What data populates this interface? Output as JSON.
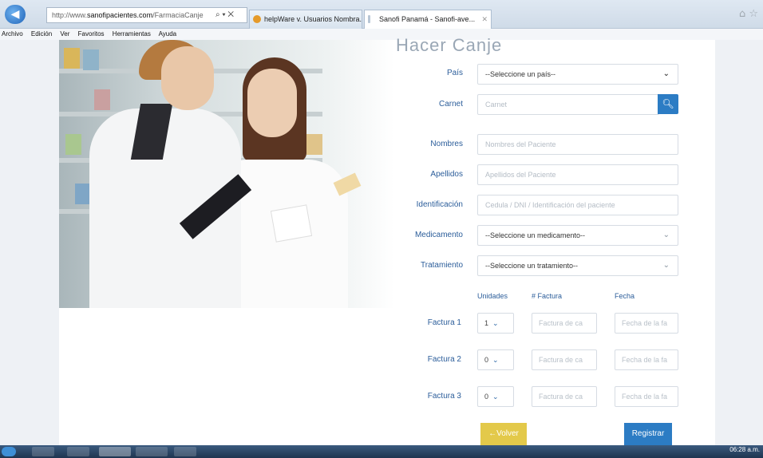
{
  "browser": {
    "url_base": "http://www.",
    "url_domain": "sanofipacientes.com",
    "url_path": "/FarmaciaCanje",
    "url_buttons": "⌕ ▾ ✕",
    "tabs": [
      {
        "label": "helpWare v. Usuarios Nombra..."
      },
      {
        "label": "Sanofi Panamá - Sanofi-ave..."
      }
    ],
    "menu": [
      "Archivo",
      "Edición",
      "Ver",
      "Favoritos",
      "Herramientas",
      "Ayuda"
    ]
  },
  "form": {
    "title": "Hacer Canje",
    "pais": {
      "label": "País",
      "value": "--Seleccione un país--"
    },
    "carnet": {
      "label": "Carnet",
      "placeholder": "Carnet"
    },
    "nombres": {
      "label": "Nombres",
      "placeholder": "Nombres del Paciente"
    },
    "apellidos": {
      "label": "Apellidos",
      "placeholder": "Apellidos del Paciente"
    },
    "identificacion": {
      "label": "Identificación",
      "placeholder": "Cedula / DNI / Identificación del paciente"
    },
    "medicamento": {
      "label": "Medicamento",
      "value": "--Seleccione un medicamento--"
    },
    "tratamiento": {
      "label": "Tratamiento",
      "value": "--Seleccione un tratamiento--"
    },
    "columns": {
      "unidades": "Unidades",
      "factura": "# Factura",
      "fecha": "Fecha"
    },
    "facturas": [
      {
        "label": "Factura 1",
        "unidades": "1",
        "factura_ph": "Factura de ca",
        "fecha_ph": "Fecha de la fa"
      },
      {
        "label": "Factura 2",
        "unidades": "0",
        "factura_ph": "Factura de ca",
        "fecha_ph": "Fecha de la fa"
      },
      {
        "label": "Factura 3",
        "unidades": "0",
        "factura_ph": "Factura de ca",
        "fecha_ph": "Fecha de la fa"
      }
    ],
    "volver_label": "←Volver",
    "registrar_label": "Registrar"
  },
  "taskbar": {
    "clock": "06:28 a.m."
  },
  "colors": {
    "accent": "#2c7cc4",
    "label": "#2b5d9a",
    "back_button": "#e3c94a"
  },
  "icons": [
    "back-arrow-icon",
    "search-icon",
    "chevron-down-icon",
    "home-icon",
    "star-icon"
  ]
}
